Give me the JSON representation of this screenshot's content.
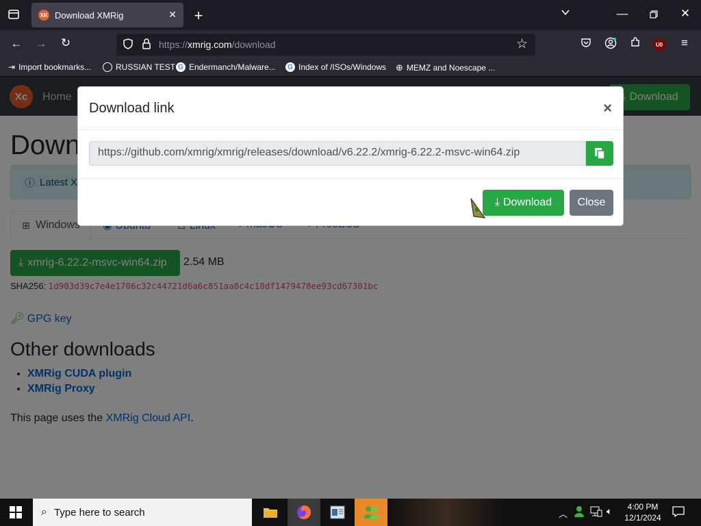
{
  "browser": {
    "tab_title": "Download XMRig",
    "tab_favicon": "XR",
    "url_protocol": "https://",
    "url_domain": "xmrig.com",
    "url_path": "/download",
    "bookmarks": [
      {
        "label": "Import bookmarks...",
        "icon": "import-icon"
      },
      {
        "label": "RUSSIAN TEST",
        "icon": "q-icon"
      },
      {
        "label": "Endermanch/Malware...",
        "icon": "google-icon"
      },
      {
        "label": "Index of /ISOs/Windows",
        "icon": "google-icon"
      },
      {
        "label": "MEMZ and Noescape ...",
        "icon": "globe-icon"
      }
    ],
    "extension_badge": "U0"
  },
  "site": {
    "logo": "Xc",
    "nav_home": "Home",
    "nav_download": "Download",
    "page_title_partial": "Down",
    "alert_partial": "Latest X",
    "tabs": [
      "Windows",
      "Ubuntu",
      "Linux",
      "macOS",
      "FreeBSD"
    ],
    "file_button": "xmrig-6.22.2-msvc-win64.zip",
    "file_size": "2.54 MB",
    "sha_label": "SHA256:",
    "sha_value": "1d903d39c7e4e1706c32c44721d6a6c851aa8c4c10df1479478ee93cd67301bc",
    "gpg_label": "GPG key",
    "other_title": "Other downloads",
    "other_links": [
      "XMRig CUDA plugin",
      "XMRig Proxy"
    ],
    "footer_prefix": "This page uses the ",
    "footer_link": "XMRig Cloud API",
    "footer_suffix": "."
  },
  "modal": {
    "title": "Download link",
    "close_symbol": "×",
    "link_value": "https://github.com/xmrig/xmrig/releases/download/v6.22.2/xmrig-6.22.2-msvc-win64.zip",
    "download_label": "Download",
    "close_label": "Close"
  },
  "taskbar": {
    "search_placeholder": "Type here to search",
    "time": "4:00 PM",
    "date": "12/1/2024"
  },
  "colors": {
    "accent_green": "#28a745",
    "firefox_dark": "#1c1b22",
    "navbar_dark": "#343a40",
    "sha_red": "#e83e8c"
  }
}
